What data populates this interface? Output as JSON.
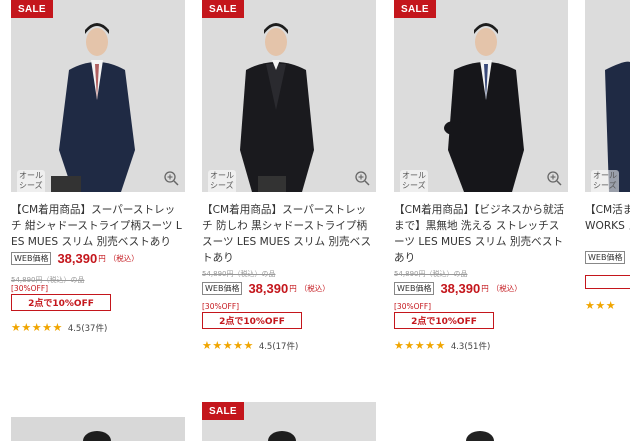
{
  "products": [
    {
      "sale_label": "SALE",
      "season_label": "オール シーズン",
      "title_prefix": "【CM着用商品】",
      "title_rest": "スーパーストレッチ 紺シャドーストライプ柄スーツ LES MUES スリム 別売ベストあり",
      "original_price": "54,890円（税込）の品",
      "web_tag": "WEB価格",
      "price": "38,390",
      "yen": "円",
      "tax": "（税込）",
      "discount_pct": "[30%OFF]",
      "promo": "2点で10%OFF",
      "rating_value": "4.5(37件)",
      "stars": "★★★★★"
    },
    {
      "sale_label": "SALE",
      "season_label": "オール シーズン",
      "title_prefix": "【CM着用商品】",
      "title_rest": "スーパーストレッチ 防しわ 黒シャドーストライプ柄スーツ LES MUES スリム 別売ベストあり",
      "original_price": "54,890円（税込）の品",
      "web_tag": "WEB価格",
      "price": "38,390",
      "yen": "円",
      "tax": "（税込）",
      "discount_pct": "[30%OFF]",
      "promo": "2点で10%OFF",
      "rating_value": "4.5(17件)",
      "stars": "★★★★★"
    },
    {
      "sale_label": "SALE",
      "season_label": "オール シーズン",
      "title_prefix": "【CM着用商品】",
      "title_rest": "【ビジネスから就活まで】黒無地 洗える ストレッチスーツ LES MUES スリム 別売ベストあり",
      "original_price": "54,890円（税込）の品",
      "web_tag": "WEB価格",
      "price": "38,390",
      "yen": "円",
      "tax": "（税込）",
      "discount_pct": "[30%OFF]",
      "promo": "2点で10%OFF",
      "rating_value": "4.3(51件)",
      "stars": "★★★★★"
    },
    {
      "season_label": "オール シーズン",
      "title_prefix": "【CM",
      "title_rest": "活まで WORKS ス",
      "web_tag": "WEB価格",
      "stars": "★★★"
    }
  ],
  "row2": [
    {
      "sale_label": ""
    },
    {
      "sale_label": "SALE"
    },
    {
      "sale_label": ""
    }
  ],
  "colors": {
    "accent": "#c4161c",
    "star": "#f0a500"
  },
  "icons": {
    "zoom": "zoom-in-icon"
  }
}
